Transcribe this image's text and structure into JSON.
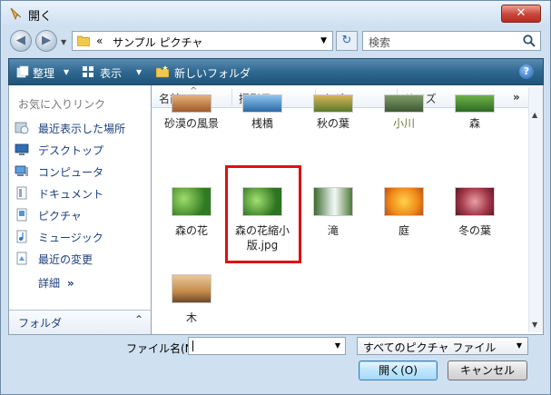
{
  "window": {
    "title": "開く",
    "close_glyph": "✕"
  },
  "nav": {
    "back_glyph": "◀",
    "forward_glyph": "▶",
    "dropdown_glyph": "▼"
  },
  "address": {
    "chevron": "«",
    "path_text": "サンプル ピクチャ",
    "dropdown_glyph": "▼"
  },
  "refresh": {
    "glyph": "↻"
  },
  "search": {
    "placeholder": "検索",
    "icon": "magnifier-icon"
  },
  "toolbar": {
    "organize_label": "整理",
    "views_label": "表示",
    "new_folder_label": "新しいフォルダ",
    "dropdown_glyph": "▾",
    "help_glyph": "?"
  },
  "sidebar": {
    "header": "お気に入りリンク",
    "items": [
      {
        "label": "最近表示した場所",
        "icon": "recent-places-icon"
      },
      {
        "label": "デスクトップ",
        "icon": "desktop-icon"
      },
      {
        "label": "コンピュータ",
        "icon": "computer-icon"
      },
      {
        "label": "ドキュメント",
        "icon": "documents-icon"
      },
      {
        "label": "ピクチャ",
        "icon": "pictures-icon"
      },
      {
        "label": "ミュージック",
        "icon": "music-icon"
      },
      {
        "label": "最近の変更",
        "icon": "recent-changes-icon"
      }
    ],
    "more_label": "詳細",
    "more_glyph": "»",
    "folders_label": "フォルダ",
    "folders_glyph": "⌃"
  },
  "columns": {
    "name": "名前",
    "date_taken": "撮影日",
    "tags": "タグ",
    "size": "サイズ",
    "sort_glyph": "^",
    "more_glyph": "»"
  },
  "files": [
    {
      "label": "砂漠の風景"
    },
    {
      "label": "桟橋"
    },
    {
      "label": "秋の葉"
    },
    {
      "label": "小川"
    },
    {
      "label": "森"
    },
    {
      "label": "森の花"
    },
    {
      "label": "森の花縮小版.jpg",
      "selected": true
    },
    {
      "label": "滝"
    },
    {
      "label": "庭"
    },
    {
      "label": "冬の葉"
    },
    {
      "label": "木"
    }
  ],
  "footer": {
    "filename_label": "ファイル名(N):",
    "filename_value": "",
    "filter_value": "すべてのピクチャ ファイル",
    "open_label": "開く(O)",
    "cancel_label": "キャンセル",
    "dropdown_glyph": "▼"
  },
  "colors": {
    "selection_outline": "#e01010",
    "toolbar": "#2f6891",
    "link_text": "#1c3f80"
  }
}
